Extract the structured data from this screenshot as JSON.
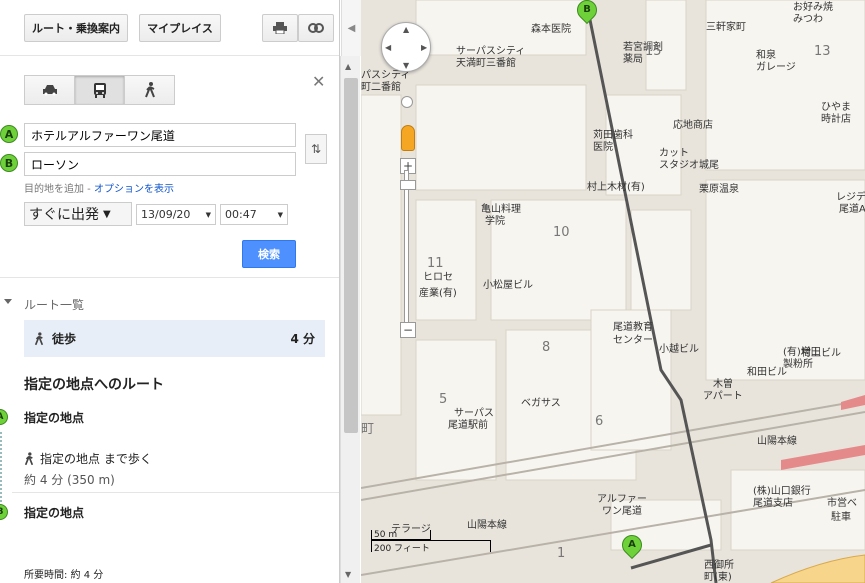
{
  "toolbar": {
    "route_label": "ルート・乗換案内",
    "myplaces_label": "マイプレイス",
    "print_icon": "print-icon",
    "link_icon": "link-icon",
    "collapse_icon": "chevron-left-icon"
  },
  "modes": [
    {
      "name": "car",
      "icon": "car-icon",
      "active": false
    },
    {
      "name": "transit",
      "icon": "bus-icon",
      "active": true
    },
    {
      "name": "walk",
      "icon": "walk-icon",
      "active": false
    }
  ],
  "form": {
    "origin_marker": "A",
    "origin_value": "ホテルアルファーワン尾道",
    "dest_marker": "B",
    "dest_value": "ローソン",
    "add_dest": "目的地を追加",
    "add_dest_sep": " - ",
    "options_link": "オプションを表示",
    "time_mode": "すぐに出発",
    "date": "13/09/20",
    "time": "00:47",
    "search_label": "検索"
  },
  "routes": {
    "heading": "ルート一覧",
    "items": [
      {
        "label": "徒歩",
        "duration": "4 分"
      }
    ]
  },
  "directions": {
    "title": "指定の地点へのルート",
    "start_name": "指定の地点",
    "step_text": "指定の地点 まで歩く",
    "step_dist": "約 4 分 (350 m)",
    "end_name": "指定の地点",
    "total": "所要時間: 約 4 分",
    "start_marker": "A",
    "end_marker": "B"
  },
  "map": {
    "labels": [
      "森本医院",
      "三軒家町",
      "お好み焼",
      "みつわ",
      "サーパスシティ",
      "天満町三番館",
      "若宮調剤",
      "薬局",
      "和泉",
      "ガレージ",
      "パスシティ",
      "町二番館",
      "ひやま",
      "時計店",
      "応地商店",
      "苅田歯科",
      "医院",
      "カット",
      "スタジオ城尾",
      "村上木材(有)",
      "栗原温泉",
      "レジデンス",
      "尾道A",
      "亀山料理",
      "学院",
      "ヒロセ",
      "産業(有)",
      "小松屋ビル",
      "尾道教育",
      "センター",
      "(有)増田",
      "製粉所",
      "小越ビル",
      "村上ビル",
      "和田ビル",
      "木曽",
      "アパート",
      "ベガサス",
      "サーパス",
      "尾道駅前",
      "山陽本線",
      "(株)山口銀行",
      "尾道支店",
      "市営ベ",
      "駐車",
      "アルファー",
      "ワン尾道",
      "山陽本線",
      "テラージ",
      "西御所",
      "町(東)"
    ],
    "block_numbers": [
      "15",
      "13",
      "10",
      "11",
      "8",
      "5",
      "6",
      "1",
      "町"
    ],
    "scale_m": "50 m",
    "scale_ft": "200 フィート",
    "pin_a": "A",
    "pin_b": "B",
    "zoom_in": "+",
    "zoom_out": "−"
  }
}
